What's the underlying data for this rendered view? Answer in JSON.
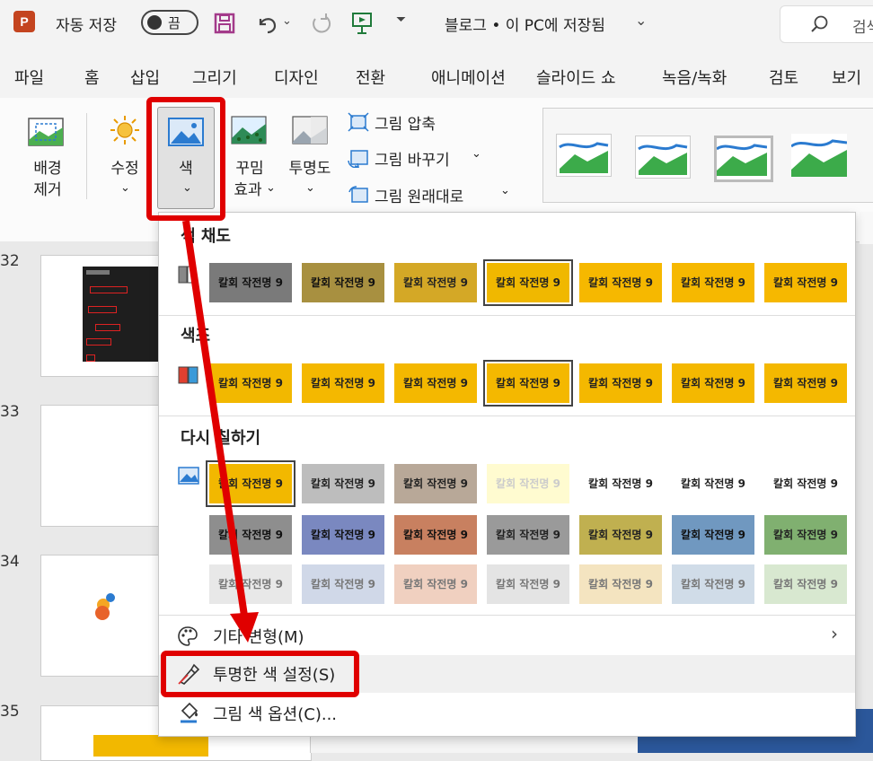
{
  "titlebar": {
    "autosave_label": "자동 저장",
    "toggle_state": "끔",
    "doc_title": "블로그 • 이 PC에 저장됨",
    "search_label": "검색"
  },
  "menubar": [
    "파일",
    "홈",
    "삽입",
    "그리기",
    "디자인",
    "전환",
    "애니메이션",
    "슬라이드 쇼",
    "녹음/녹화",
    "검토",
    "보기"
  ],
  "ribbon": {
    "remove_bg": [
      "배경",
      "제거"
    ],
    "corrections": "수정",
    "color": "색",
    "artistic": [
      "꾸밈",
      "효과"
    ],
    "transparency": "투명도",
    "compress": "그림 압축",
    "change_picture": "그림 바꾸기",
    "reset_picture": "그림 원래대로"
  },
  "slides": [
    "32",
    "33",
    "34",
    "35"
  ],
  "dropdown": {
    "saturation_title": "색 채도",
    "tone_title": "색조",
    "recolor_title": "다시 칠하기",
    "swatch_text": "칼회 작전명 9",
    "more_variations": "기타 변형(M)",
    "set_transparent": "투명한 색 설정(S)",
    "picture_color_options": "그림 색 옵션(C)...",
    "saturation_colors": [
      "#7a7a7a",
      "#a89040",
      "#d4a826",
      "#f0b800",
      "#f6b800",
      "#f6b800",
      "#f6b800"
    ],
    "tone_colors": [
      "#f2b800",
      "#f4b800",
      "#f4b800",
      "#f4b800",
      "#f4b800",
      "#f4b800",
      "#f4b800"
    ],
    "recolor_row1": [
      "#f2b800",
      "#bdbdbd",
      "#b8a898",
      "#fffbd0",
      "#ffffff",
      "#ffffff",
      "#ffffff"
    ],
    "recolor_row2": [
      "#8e8e8e",
      "#7a88c0",
      "#c88060",
      "#9a9a9a",
      "#c0b050",
      "#7098c0",
      "#80b070"
    ],
    "recolor_row3": [
      "#e8e8e8",
      "#d0d8e8",
      "#f0d0c0",
      "#e4e4e4",
      "#f4e4c0",
      "#d0dce8",
      "#d8e8d0"
    ]
  }
}
